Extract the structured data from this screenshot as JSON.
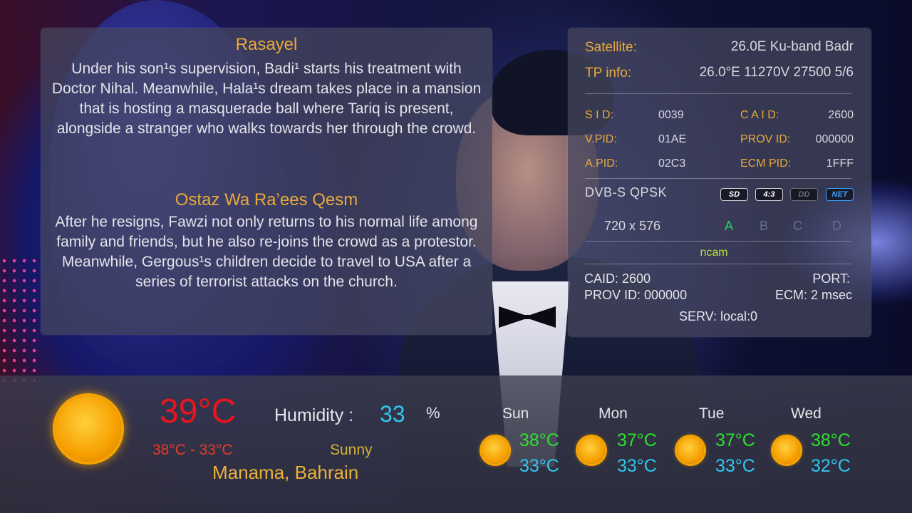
{
  "epg": {
    "now_title": "Rasayel",
    "now_description": "Under his son¹s supervision, Badi¹ starts his treatment with Doctor Nihal. Meanwhile, Hala¹s dream takes place in a mansion that is hosting a masquerade ball where Tariq is present, alongside a stranger who walks towards her through the crowd.",
    "next_title": "Ostaz Wa Ra’ees Qesm",
    "next_description": "After he resigns, Fawzi not only returns to his normal life among family and friends, but he also re-joins the crowd as a protestor. Meanwhile, Gergous¹s children decide to travel to USA after a series of terrorist attacks on the church."
  },
  "tech": {
    "satellite_label": "Satellite:",
    "satellite_value": "26.0E Ku-band Badr",
    "tp_label": "TP info:",
    "tp_value": "26.0°E 11270V 27500 5/6",
    "sid_label": "S I D:",
    "sid_value": "0039",
    "caid_label": "C A I D:",
    "caid_value": "2600",
    "vpid_label": "V.PID:",
    "vpid_value": "01AE",
    "provid_label": "PROV ID:",
    "provid_value": "000000",
    "apid_label": "A.PID:",
    "apid_value": "02C3",
    "ecmpid_label": "ECM PID:",
    "ecmpid_value": "1FFF",
    "modulation": "DVB-S  QPSK",
    "badges": [
      "SD",
      "4:3",
      "DD",
      "NET"
    ],
    "resolution": "720  x  576",
    "crypt_slots": [
      "A",
      "B",
      "C",
      "D"
    ],
    "emu": "ncam",
    "ecm_caid": "CAID: 2600",
    "ecm_port": "PORT:",
    "ecm_provid": "PROV ID: 000000",
    "ecm_time": "ECM: 2 msec",
    "ecm_serv": "SERV: local:0"
  },
  "weather": {
    "temperature": "39°C",
    "range": "38°C - 33°C",
    "humidity_label": "Humidity :",
    "humidity_value": "33",
    "humidity_unit": "%",
    "condition": "Sunny",
    "location": "Manama, Bahrain",
    "forecast": [
      {
        "day": "Sun",
        "high": "38°C",
        "low": "33°C"
      },
      {
        "day": "Mon",
        "high": "37°C",
        "low": "33°C"
      },
      {
        "day": "Tue",
        "high": "37°C",
        "low": "33°C"
      },
      {
        "day": "Wed",
        "high": "38°C",
        "low": "32°C"
      }
    ]
  },
  "colors": {
    "label_gold": "#e9a93a",
    "temp_red": "#e8141e",
    "high_green": "#2ee02e",
    "low_cyan": "#31c5ee",
    "crypt_active": "#2bd46a"
  }
}
